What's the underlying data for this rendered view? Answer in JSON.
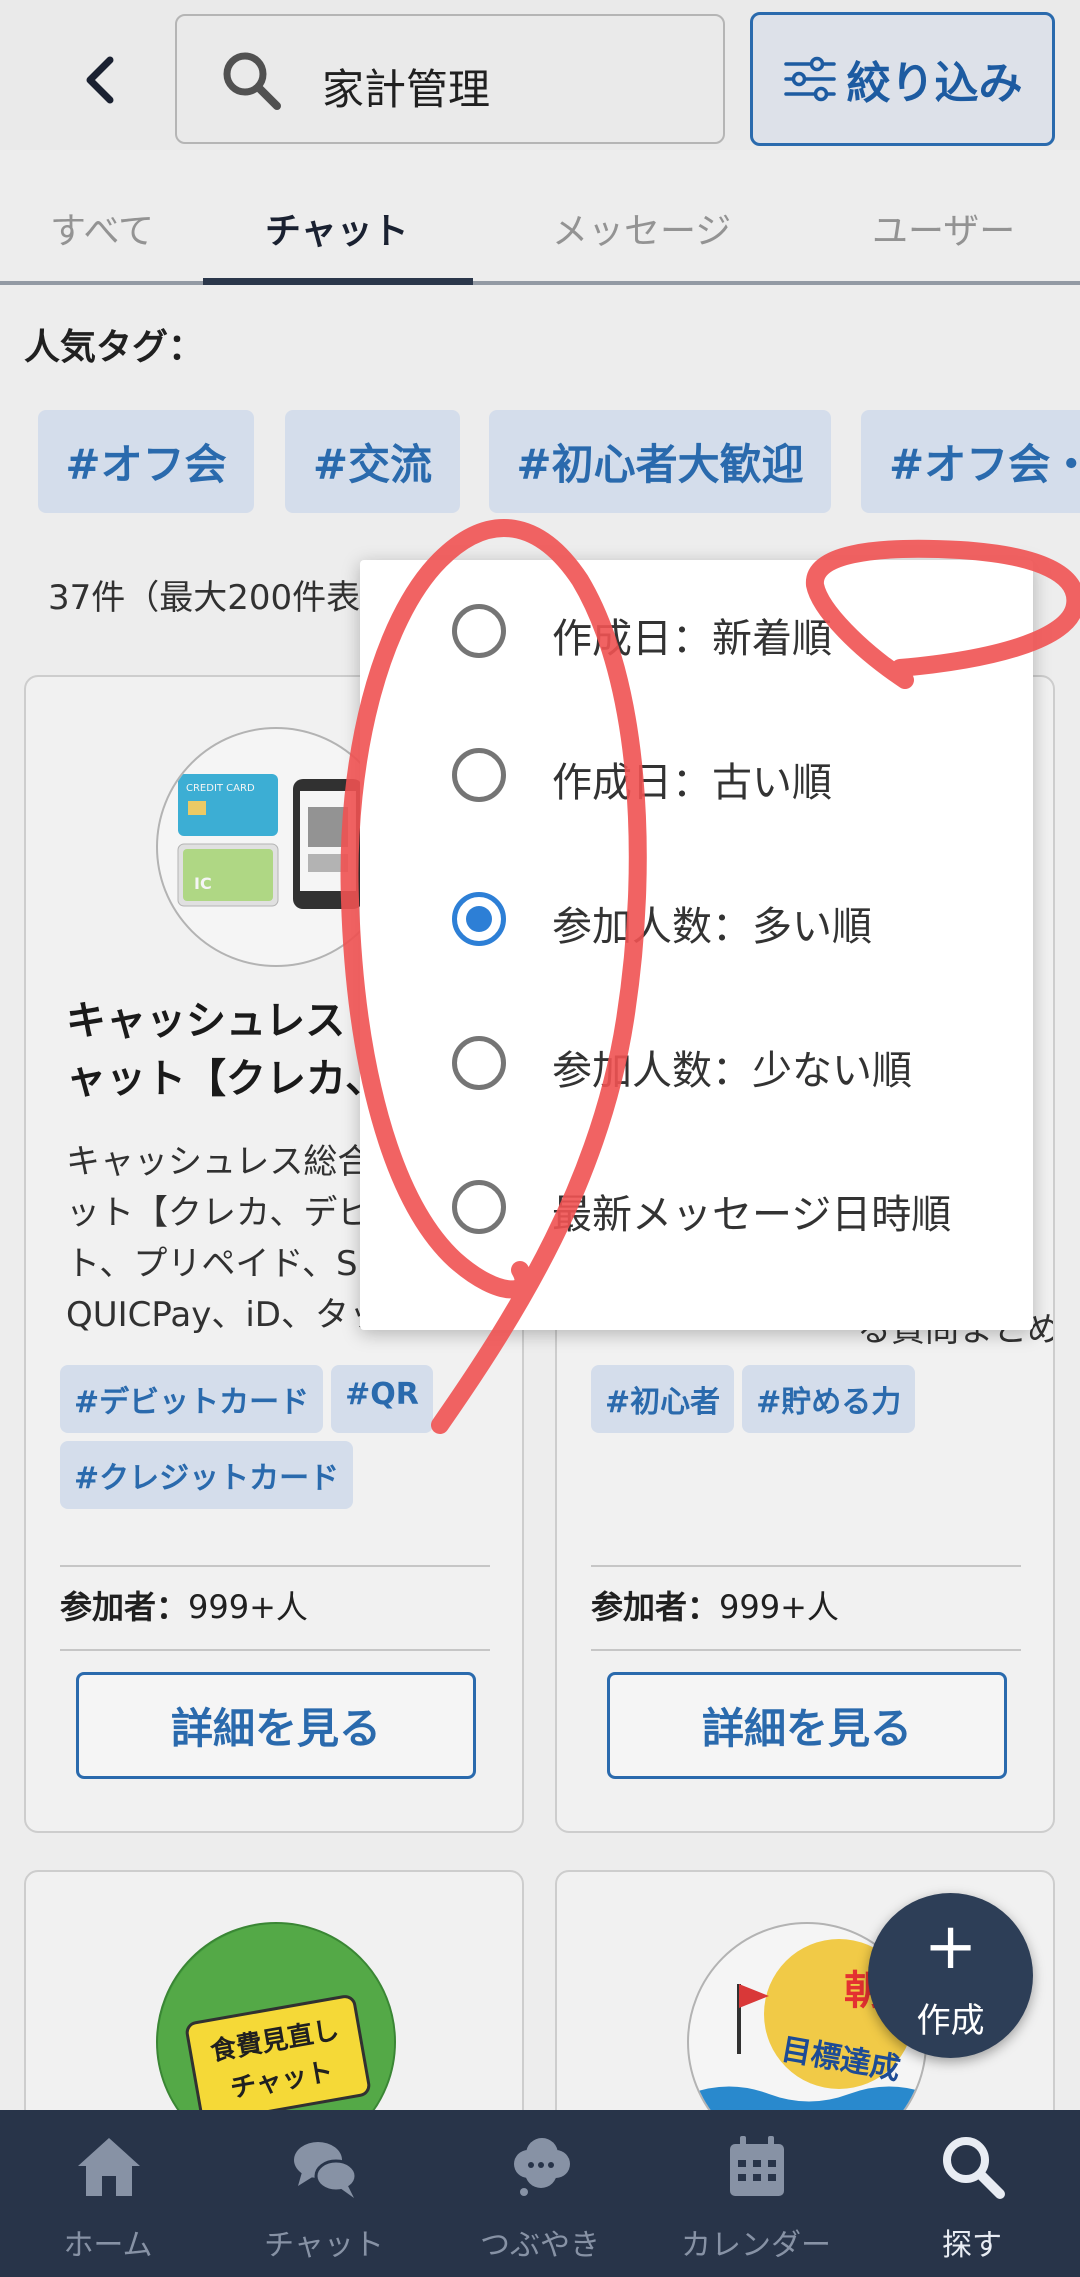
{
  "header": {
    "search_value": "家計管理",
    "filter_label": "絞り込み"
  },
  "tabs": [
    {
      "label": "すべて"
    },
    {
      "label": "チャット"
    },
    {
      "label": "メッセージ"
    },
    {
      "label": "ユーザー"
    }
  ],
  "popular_tags": {
    "label": "人気タグ：",
    "items": [
      "#オフ会",
      "#交流",
      "#初心者大歓迎",
      "#オフ会・"
    ]
  },
  "result_count": "37件（最大200件表",
  "cards": [
    {
      "title": "キャッシュレス\nャット【クレカ、",
      "desc": "キャッシュレス総合\nット【クレカ、デビ\nト、プリペイド、S\nQUICPay、iD、タッチ...",
      "tags": [
        "#デビットカード",
        "#QR",
        "#クレジットカード"
      ],
      "participants_label": "参加者：",
      "participants_value": "999+人",
      "button": "詳細を見る"
    },
    {
      "desc_tail": "る質問まとめ】ペナ...",
      "tags": [
        "#初心者",
        "#貯める力"
      ],
      "participants_label": "参加者：",
      "participants_value": "999+人",
      "button": "詳細を見る"
    }
  ],
  "card_images": {
    "credit_text": "CREDIT CARD",
    "ic_text": "IC",
    "food_text_1": "食費見直し",
    "food_text_2": "チャット",
    "morning_text_1": "朝",
    "morning_text_2": "目標達成"
  },
  "sort_menu": {
    "selected": 2,
    "options": [
      "作成日：新着順",
      "作成日：古い順",
      "参加人数：多い順",
      "参加人数：少ない順",
      "最新メッセージ日時順"
    ]
  },
  "fab": {
    "plus": "+",
    "label": "作成"
  },
  "bottom_nav": [
    {
      "label": "ホーム",
      "icon": "home-icon"
    },
    {
      "label": "チャット",
      "icon": "chat-icon"
    },
    {
      "label": "つぶやき",
      "icon": "tweet-icon"
    },
    {
      "label": "カレンダー",
      "icon": "calendar-icon"
    },
    {
      "label": "探す",
      "icon": "search-icon"
    }
  ],
  "colors": {
    "accent": "#2c6fb5",
    "nav_bg": "#283449",
    "radio_selected": "#2d7fd6",
    "annotation": "#f05252"
  }
}
